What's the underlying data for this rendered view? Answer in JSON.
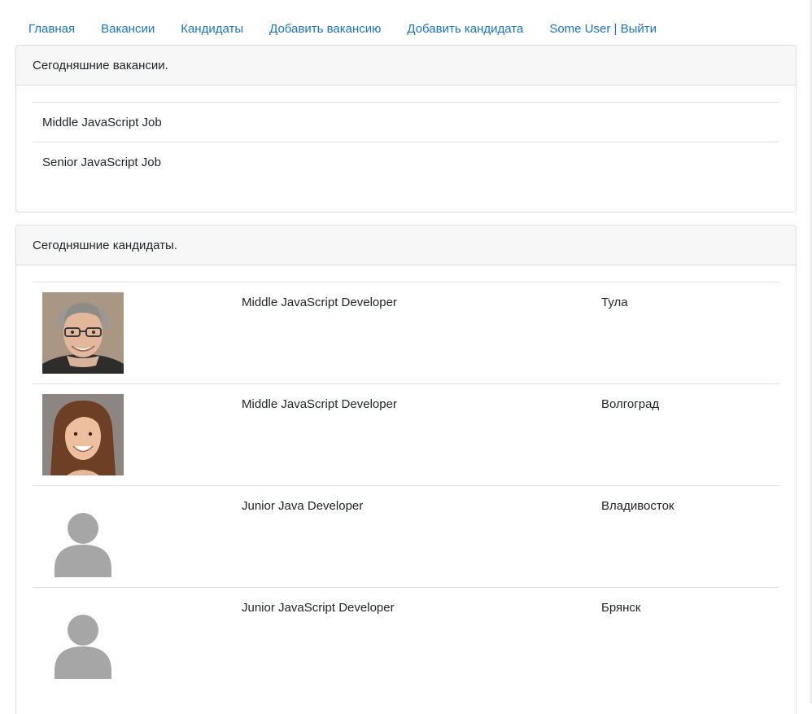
{
  "nav": {
    "items": [
      {
        "label": "Главная"
      },
      {
        "label": "Вакансии"
      },
      {
        "label": "Кандидаты"
      },
      {
        "label": "Добавить вакансию"
      },
      {
        "label": "Добавить кандидата"
      },
      {
        "label": "Some User | Выйти"
      }
    ],
    "link_color": "#1a73c8"
  },
  "vacancies": {
    "header": "Сегодняшние вакансии.",
    "items": [
      {
        "title": "Middle JavaScript Job"
      },
      {
        "title": "Senior JavaScript Job"
      }
    ]
  },
  "candidates": {
    "header": "Сегодняшние кандидаты.",
    "items": [
      {
        "photo": "man-photo",
        "position": "Middle JavaScript Developer",
        "city": "Тула"
      },
      {
        "photo": "woman-photo",
        "position": "Middle JavaScript Developer",
        "city": "Волгоград"
      },
      {
        "photo": "avatar-placeholder-icon",
        "position": "Junior Java Developer",
        "city": "Владивосток"
      },
      {
        "photo": "avatar-placeholder-icon",
        "position": "Junior JavaScript Developer",
        "city": "Брянск"
      }
    ]
  }
}
